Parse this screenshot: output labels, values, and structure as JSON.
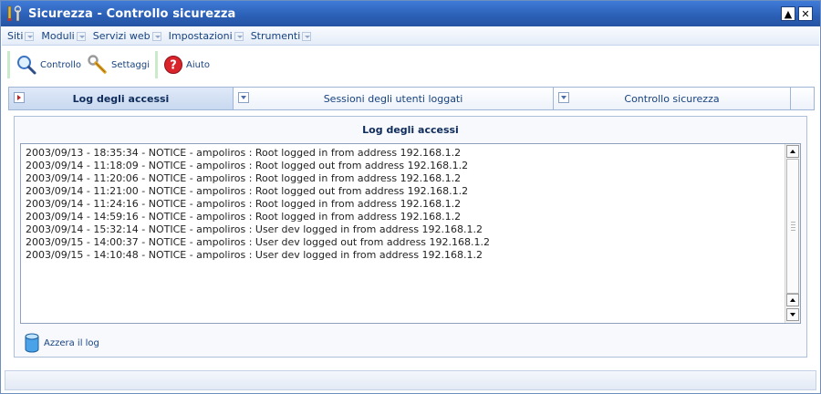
{
  "window": {
    "title": "Sicurezza - Controllo sicurezza",
    "buttons": {
      "maximize": "▲",
      "close": "✕"
    }
  },
  "menu": {
    "items": [
      "Siti",
      "Moduli",
      "Servizi web",
      "Impostazioni",
      "Strumenti"
    ]
  },
  "toolbar": {
    "controllo_label": "Controllo",
    "settaggi_label": "Settaggi",
    "aiuto_label": "Aiuto"
  },
  "tabs": [
    {
      "label": "Log degli accessi",
      "active": true
    },
    {
      "label": "Sessioni degli utenti loggati",
      "active": false
    },
    {
      "label": "Controllo sicurezza",
      "active": false
    }
  ],
  "panel": {
    "title": "Log degli accessi",
    "log_lines": [
      "2003/09/13 - 18:35:34 - NOTICE - ampoliros : Root logged in from address 192.168.1.2",
      "2003/09/14 - 11:18:09 - NOTICE - ampoliros : Root logged out from address 192.168.1.2",
      "2003/09/14 - 11:20:06 - NOTICE - ampoliros : Root logged in from address 192.168.1.2",
      "2003/09/14 - 11:21:00 - NOTICE - ampoliros : Root logged out from address 192.168.1.2",
      "2003/09/14 - 11:24:16 - NOTICE - ampoliros : Root logged in from address 192.168.1.2",
      "2003/09/14 - 14:59:16 - NOTICE - ampoliros : Root logged in from address 192.168.1.2",
      "2003/09/14 - 15:32:14 - NOTICE - ampoliros : User dev logged in from address 192.168.1.2",
      "2003/09/15 - 14:00:37 - NOTICE - ampoliros : User dev logged out from address 192.168.1.2",
      "2003/09/15 - 14:10:48 - NOTICE - ampoliros : User dev logged in from address 192.168.1.2"
    ],
    "clear_label": "Azzera il log"
  },
  "colors": {
    "titlebar": "#2b5fb5",
    "accent_text": "#17427f",
    "active_tab": "#c9d9f0",
    "separator": "#c9ebc9"
  },
  "icons": {
    "app": "tools-icon",
    "controllo": "magnifier-icon",
    "settaggi": "wrench-icon",
    "aiuto": "help-icon",
    "clear": "database-icon"
  }
}
